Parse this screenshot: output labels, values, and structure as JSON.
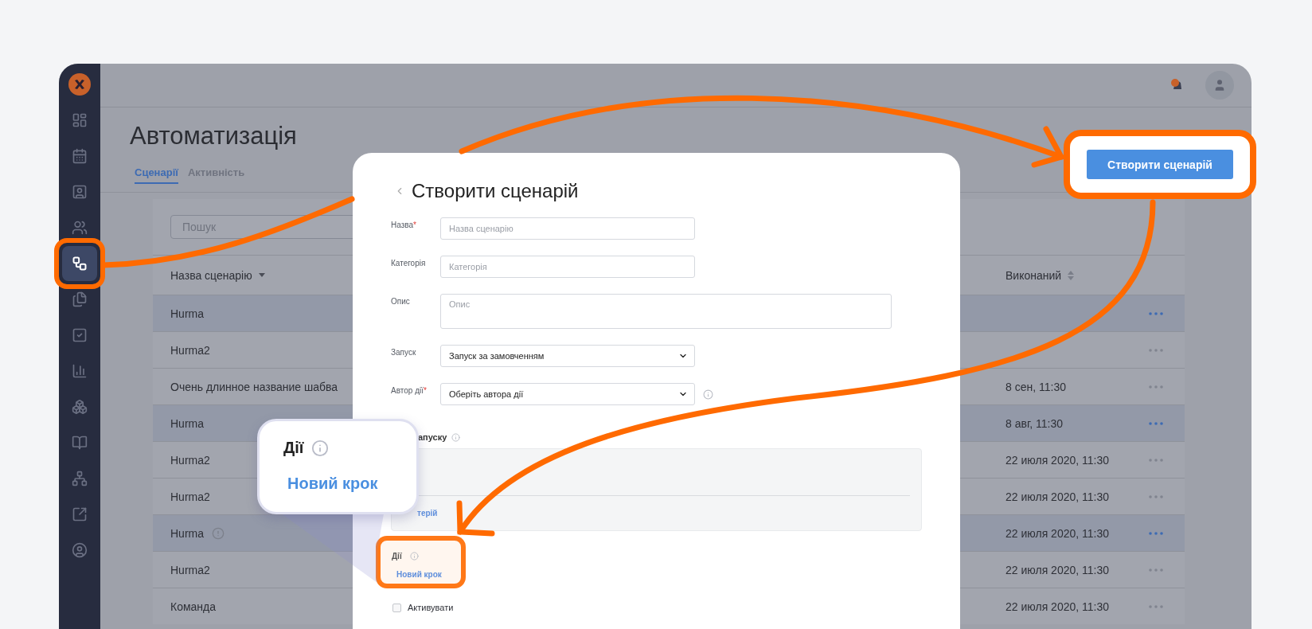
{
  "sidebar": {
    "items": [
      {
        "selected": false
      },
      {
        "selected": false
      },
      {
        "selected": false
      },
      {
        "selected": false
      },
      {
        "selected": true
      },
      {
        "selected": false
      },
      {
        "selected": false
      },
      {
        "selected": false
      },
      {
        "selected": false
      },
      {
        "selected": false
      },
      {
        "selected": false
      },
      {
        "selected": false
      },
      {
        "selected": false
      }
    ]
  },
  "page": {
    "title": "Автоматизація",
    "tabs": [
      {
        "label": "Сценарії",
        "selected": true
      },
      {
        "label": "Активність",
        "selected": false
      }
    ],
    "create_button": "Створити сценарій"
  },
  "table": {
    "search": {
      "placeholder": "Пошук"
    },
    "columns": [
      "Назва сценарію",
      "Виконаний"
    ],
    "rows": [
      {
        "name": "Hurma",
        "highlighted": true,
        "warning": false
      },
      {
        "name": "Hurma2",
        "highlighted": false,
        "warning": false
      },
      {
        "name": "Очень длинное название шабва",
        "executed": "8 сен, 11:30",
        "highlighted": false,
        "warning": false
      },
      {
        "name": "Hurma",
        "executed": "8 авг, 11:30",
        "highlighted": true,
        "warning": false
      },
      {
        "name": "Hurma2",
        "executed": "22 июля 2020, 11:30",
        "highlighted": false,
        "warning": false
      },
      {
        "name": "Hurma2",
        "executed": "22 июля 2020, 11:30",
        "highlighted": false,
        "warning": false
      },
      {
        "name": "Hurma",
        "executed": "22 июля 2020, 11:30",
        "highlighted": true,
        "warning": true
      },
      {
        "name": "Hurma2",
        "executed": "22 июля 2020, 11:30",
        "highlighted": false,
        "warning": false
      },
      {
        "name": "Команда",
        "executed": "22 июля 2020, 11:30",
        "highlighted": false,
        "warning": false
      }
    ]
  },
  "modal": {
    "title": "Створити сценарій",
    "fields": [
      {
        "kind": "input",
        "label": "Назва",
        "required_mark": "*",
        "placeholder": "Назва сценарію",
        "info": false
      },
      {
        "kind": "input",
        "label": "Категорія",
        "placeholder": "Категорія",
        "info": false
      },
      {
        "kind": "textarea",
        "label": "Опис",
        "placeholder": "Опис",
        "info": false
      },
      {
        "kind": "select",
        "label": "Запуск",
        "value": "Запуск за замовченням",
        "info": false
      },
      {
        "kind": "select",
        "label": "Автор дії",
        "required_mark": "*",
        "value": "Оберіть автора дії",
        "info": true
      }
    ],
    "trigger": {
      "label": "апуску",
      "link": "терій"
    },
    "actions": {
      "label": "Дії",
      "link": "Новий крок"
    },
    "activate": {
      "label": "Активувати",
      "checked": false
    }
  },
  "callout": {
    "label": "Дії",
    "link": "Новий крок"
  }
}
